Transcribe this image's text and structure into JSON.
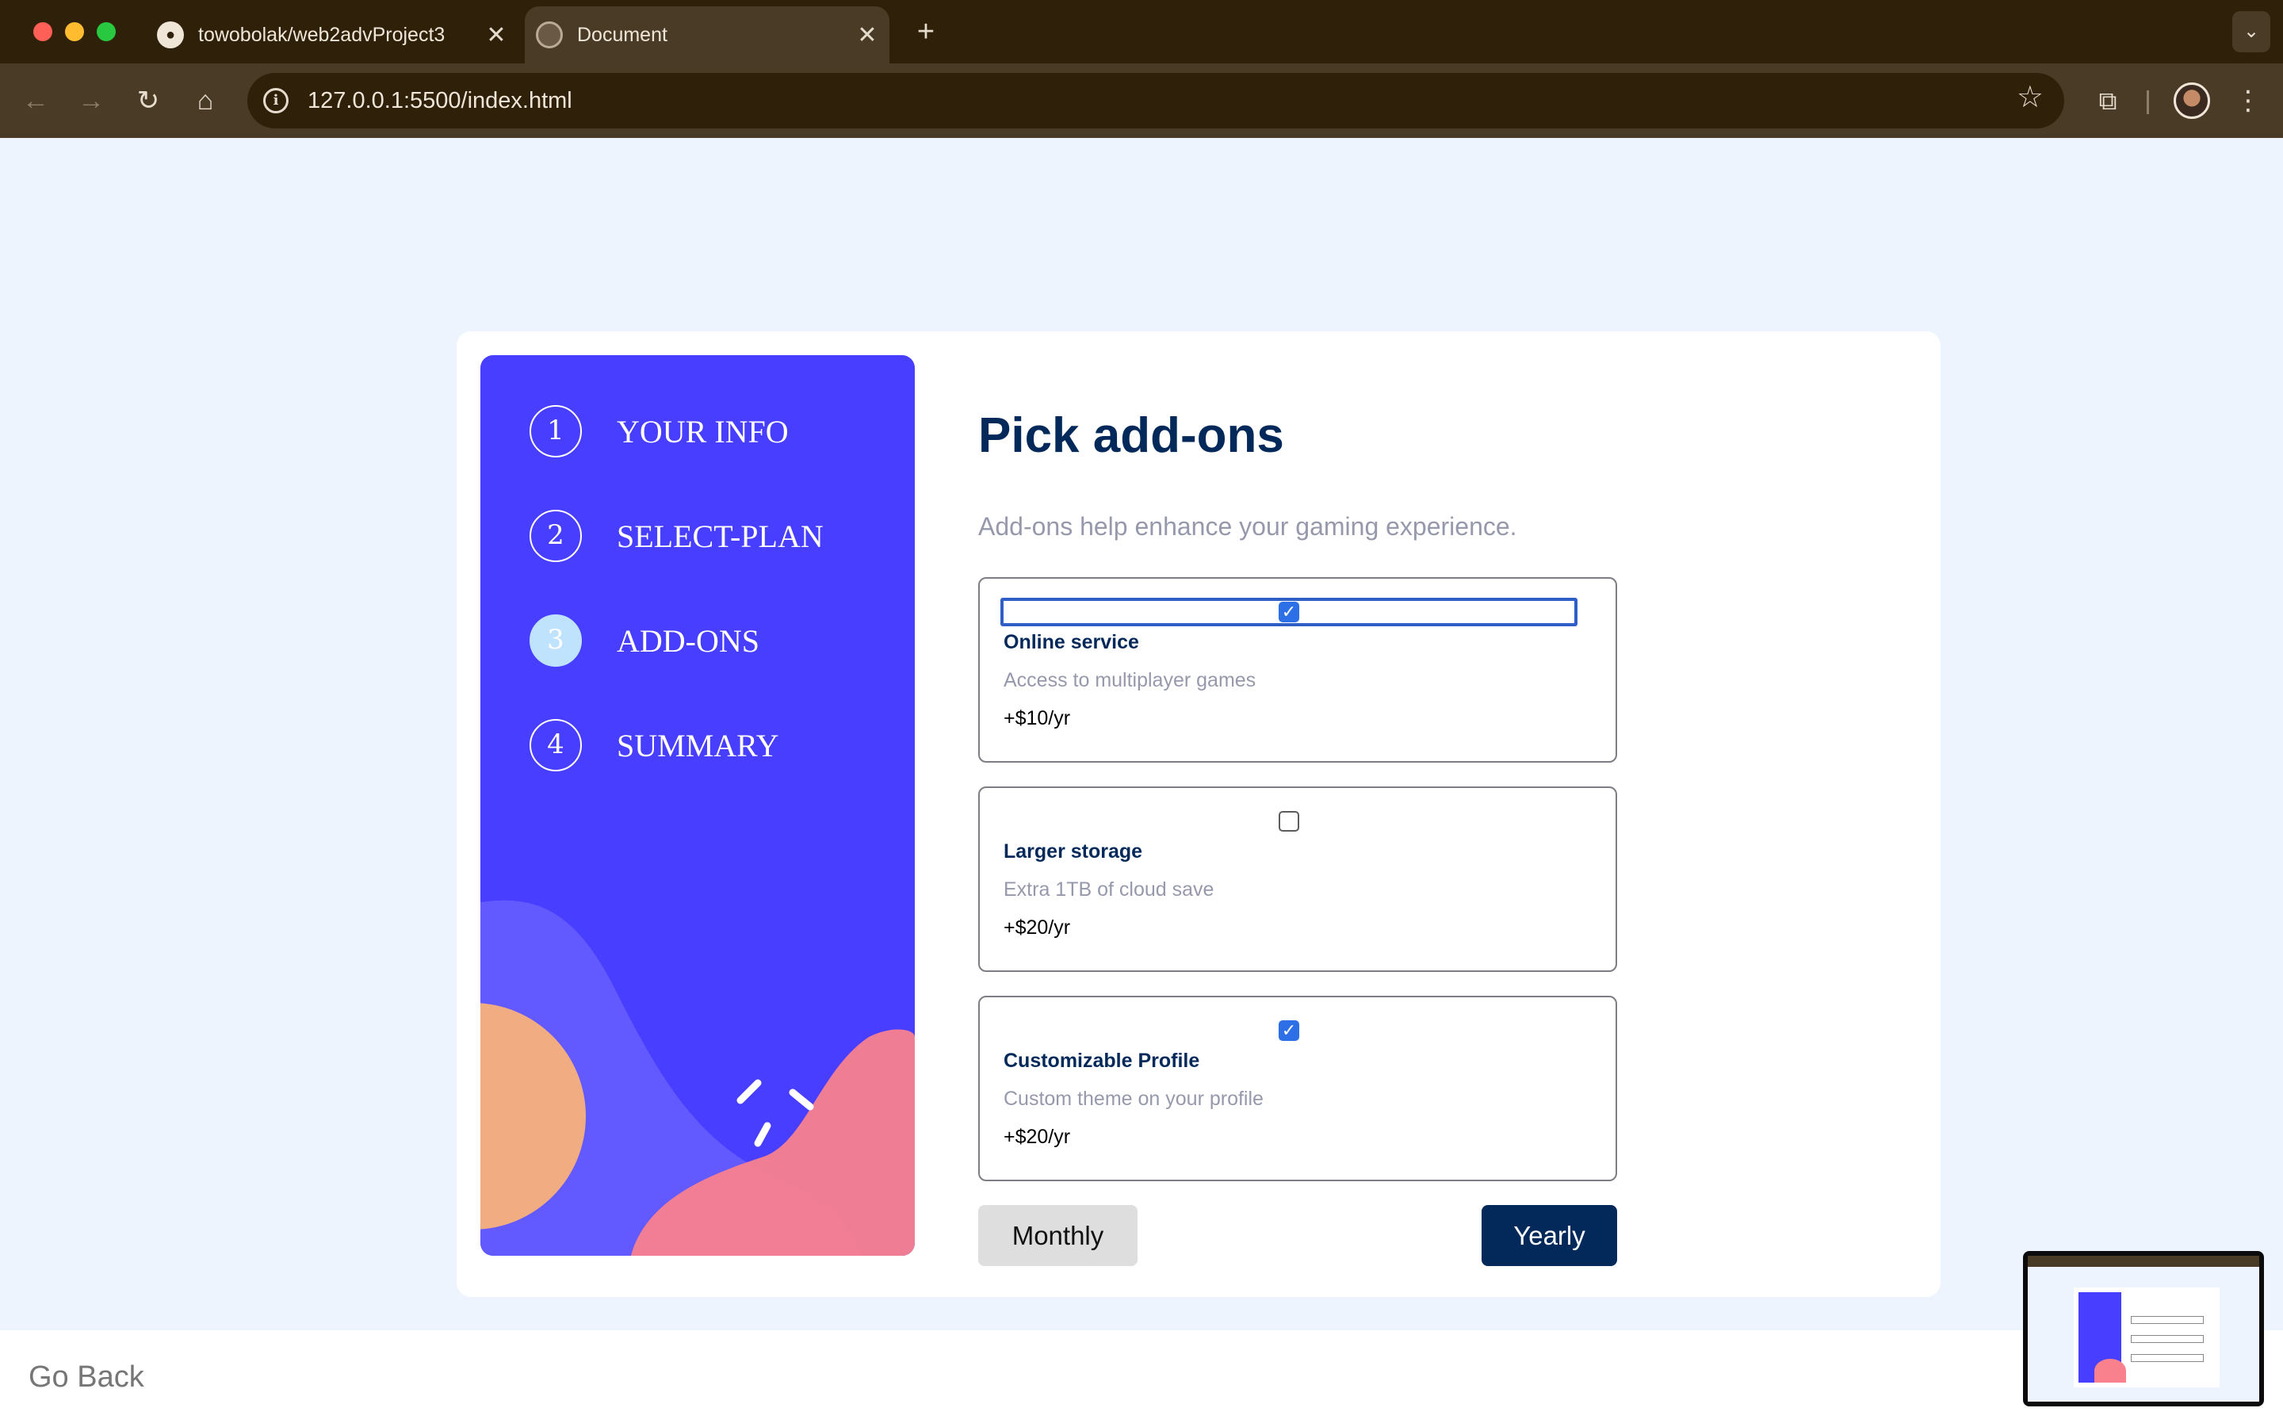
{
  "browser": {
    "tabs": [
      {
        "title": "towobolak/web2advProject3",
        "favicon": "github-icon",
        "active": false
      },
      {
        "title": "Document",
        "favicon": "globe-icon",
        "active": true
      }
    ],
    "url": "127.0.0.1:5500/index.html",
    "theme_colors": {
      "frame": "#2f200a",
      "toolbar": "#4a3b26"
    }
  },
  "sidebar": {
    "steps": [
      {
        "number": "1",
        "label": "YOUR INFO",
        "active": false
      },
      {
        "number": "2",
        "label": "SELECT-PLAN",
        "active": false
      },
      {
        "number": "3",
        "label": "ADD-ONS",
        "active": true
      },
      {
        "number": "4",
        "label": "SUMMARY",
        "active": false
      }
    ],
    "background": "#483eff"
  },
  "main": {
    "title": "Pick add-ons",
    "subtitle": "Add-ons help enhance your gaming experience.",
    "addons": [
      {
        "name": "Online service",
        "description": "Access to multiplayer games",
        "price": "+$10/yr",
        "checked": true
      },
      {
        "name": "Larger storage",
        "description": "Extra 1TB of cloud save",
        "price": "+$20/yr",
        "checked": false
      },
      {
        "name": "Customizable Profile",
        "description": "Custom theme on your profile",
        "price": "+$20/yr",
        "checked": true
      }
    ],
    "buttons": {
      "monthly": "Monthly",
      "yearly": "Yearly"
    }
  },
  "footer": {
    "go_back": "Go Back"
  },
  "colors": {
    "primary": "#03295a",
    "accent": "#483eff",
    "muted": "#9699ab",
    "page_bg": "#eef4fd"
  }
}
